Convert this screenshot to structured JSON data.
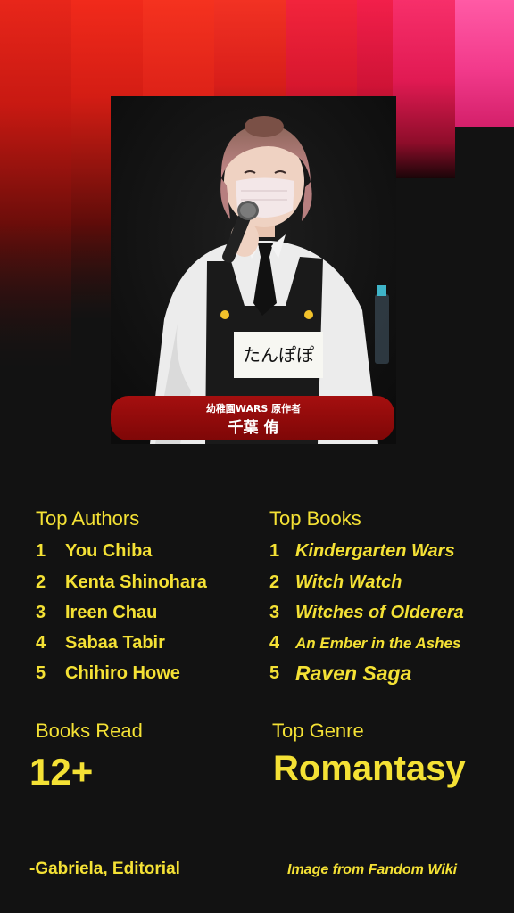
{
  "colors": {
    "accent": "#f4e135",
    "background": "#121212"
  },
  "photo": {
    "caption_line1": "幼稚園WARS 原作者",
    "caption_line2": "千葉 侑",
    "apron_tag": "たんぽぽ"
  },
  "top_authors": {
    "heading": "Top Authors",
    "items": [
      {
        "rank": "1",
        "name": "You Chiba"
      },
      {
        "rank": "2",
        "name": "Kenta Shinohara"
      },
      {
        "rank": "3",
        "name": "Ireen Chau"
      },
      {
        "rank": "4",
        "name": "Sabaa Tabir"
      },
      {
        "rank": "5",
        "name": "Chihiro Howe"
      }
    ]
  },
  "top_books": {
    "heading": "Top Books",
    "items": [
      {
        "rank": "1",
        "title": "Kindergarten Wars"
      },
      {
        "rank": "2",
        "title": "Witch Watch"
      },
      {
        "rank": "3",
        "title": "Witches of Olderera"
      },
      {
        "rank": "4",
        "title": "An Ember in the Ashes"
      },
      {
        "rank": "5",
        "title": "Raven Saga"
      }
    ]
  },
  "books_read": {
    "heading": "Books Read",
    "value": "12+"
  },
  "top_genre": {
    "heading": "Top Genre",
    "value": "Romantasy"
  },
  "footer": {
    "attribution": "-Gabriela, Editorial",
    "image_credit": "Image from Fandom Wiki"
  }
}
